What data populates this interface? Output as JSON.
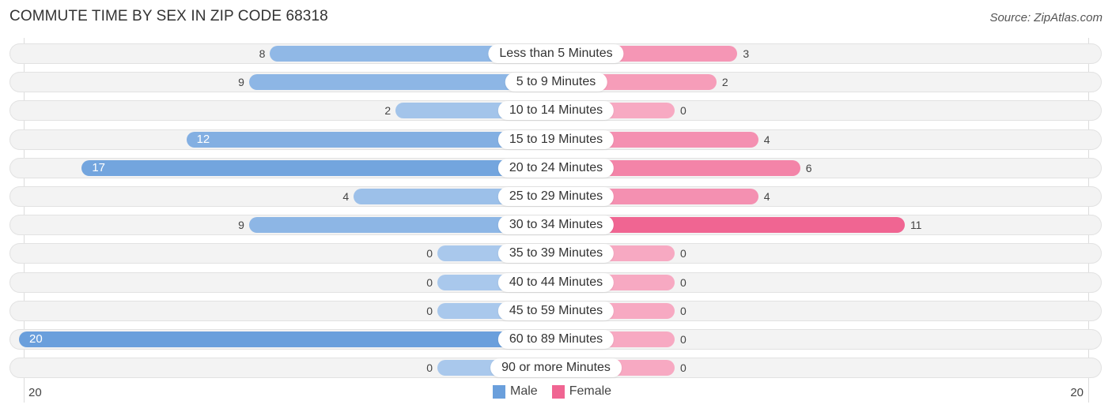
{
  "header": {
    "title": "COMMUTE TIME BY SEX IN ZIP CODE 68318",
    "source": "Source: ZipAtlas.com"
  },
  "colors": {
    "male": "#6a9fdc",
    "male_light": "#a9c8ec",
    "female": "#f06592",
    "female_light": "#f7a9c2"
  },
  "chart_data": {
    "type": "bar",
    "orientation": "horizontal-diverging",
    "title": "COMMUTE TIME BY SEX IN ZIP CODE 68318",
    "categories": [
      "Less than 5 Minutes",
      "5 to 9 Minutes",
      "10 to 14 Minutes",
      "15 to 19 Minutes",
      "20 to 24 Minutes",
      "25 to 29 Minutes",
      "30 to 34 Minutes",
      "35 to 39 Minutes",
      "40 to 44 Minutes",
      "45 to 59 Minutes",
      "60 to 89 Minutes",
      "90 or more Minutes"
    ],
    "series": [
      {
        "name": "Male",
        "side": "left",
        "values": [
          8,
          9,
          2,
          12,
          17,
          4,
          9,
          0,
          0,
          0,
          20,
          0
        ]
      },
      {
        "name": "Female",
        "side": "right",
        "values": [
          3,
          2,
          0,
          4,
          6,
          4,
          11,
          0,
          0,
          0,
          0,
          0
        ]
      }
    ],
    "axis": {
      "left_label": "20",
      "right_label": "20",
      "max": 20
    },
    "legend": {
      "position": "bottom-center",
      "entries": [
        "Male",
        "Female"
      ]
    },
    "grid": false
  }
}
